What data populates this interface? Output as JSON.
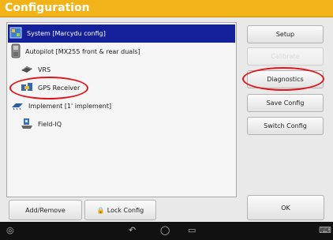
{
  "window": {
    "title": "Configuration"
  },
  "config_tree": [
    {
      "label": "System [Marcydu config]",
      "icon": "system-config-icon",
      "selected": true
    },
    {
      "label": "Autopilot [MX255 front & rear duals]",
      "icon": "autopilot-controller-icon",
      "selected": false
    },
    {
      "label": "VRS",
      "icon": "vrs-icon",
      "selected": false
    },
    {
      "label": "GPS Receiver",
      "icon": "gps-receiver-icon",
      "selected": false
    },
    {
      "label": "Implement [1' implement]",
      "icon": "implement-icon",
      "selected": false
    },
    {
      "label": "Field-IQ",
      "icon": "field-iq-icon",
      "selected": false
    }
  ],
  "side_buttons": {
    "setup": "Setup",
    "calibrate": "Calibrate",
    "diagnostics": "Diagnostics",
    "save_config": "Save Config",
    "switch_config": "Switch Config"
  },
  "bottom_buttons": {
    "add_remove": "Add/Remove",
    "lock_config": "Lock Config",
    "ok": "OK"
  },
  "colors": {
    "title_bar": "#f2b318",
    "selection": "#15219a",
    "highlight": "#e0141b"
  },
  "navbar": {
    "icons": [
      "android-logo-icon",
      "back-icon",
      "home-icon",
      "recent-apps-icon",
      "keyboard-icon"
    ]
  }
}
